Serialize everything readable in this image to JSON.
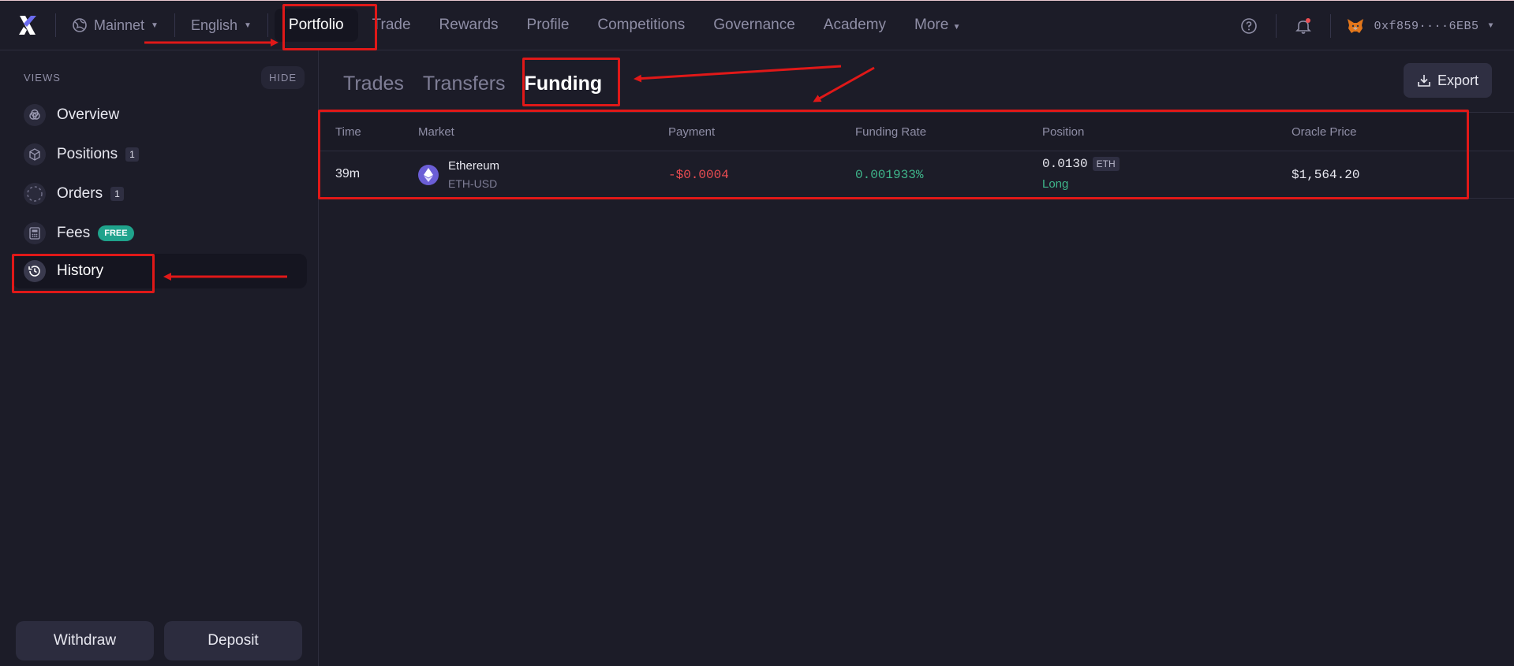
{
  "topbar": {
    "network": "Mainnet",
    "language": "English",
    "nav": [
      {
        "label": "Portfolio",
        "active": true
      },
      {
        "label": "Trade"
      },
      {
        "label": "Rewards"
      },
      {
        "label": "Profile"
      },
      {
        "label": "Competitions"
      },
      {
        "label": "Governance"
      },
      {
        "label": "Academy"
      },
      {
        "label": "More"
      }
    ],
    "wallet_address": "0xf859····6EB5"
  },
  "sidebar": {
    "views_label": "VIEWS",
    "hide_label": "HIDE",
    "items": [
      {
        "label": "Overview",
        "icon": "overview-icon"
      },
      {
        "label": "Positions",
        "icon": "cube-icon",
        "count": "1"
      },
      {
        "label": "Orders",
        "icon": "dashed-circle-icon",
        "count": "1"
      },
      {
        "label": "Fees",
        "icon": "calculator-icon",
        "badge": "FREE"
      },
      {
        "label": "History",
        "icon": "clock-history-icon",
        "active": true
      }
    ],
    "withdraw_label": "Withdraw",
    "deposit_label": "Deposit"
  },
  "main": {
    "tabs": [
      {
        "label": "Trades"
      },
      {
        "label": "Transfers"
      },
      {
        "label": "Funding",
        "active": true
      }
    ],
    "export_label": "Export",
    "table": {
      "headers": [
        "Time",
        "Market",
        "Payment",
        "Funding Rate",
        "Position",
        "Oracle Price"
      ],
      "rows": [
        {
          "time": "39m",
          "market_name": "Ethereum",
          "market_pair": "ETH-USD",
          "payment": "-$0.0004",
          "funding_rate": "0.001933%",
          "position_size": "0.0130",
          "position_unit": "ETH",
          "position_side": "Long",
          "oracle_price": "$1,564.20"
        }
      ]
    }
  },
  "colors": {
    "accent_red": "#e01818",
    "negative": "#ec4d52",
    "positive": "#3fb68b",
    "background": "#1c1c28"
  }
}
